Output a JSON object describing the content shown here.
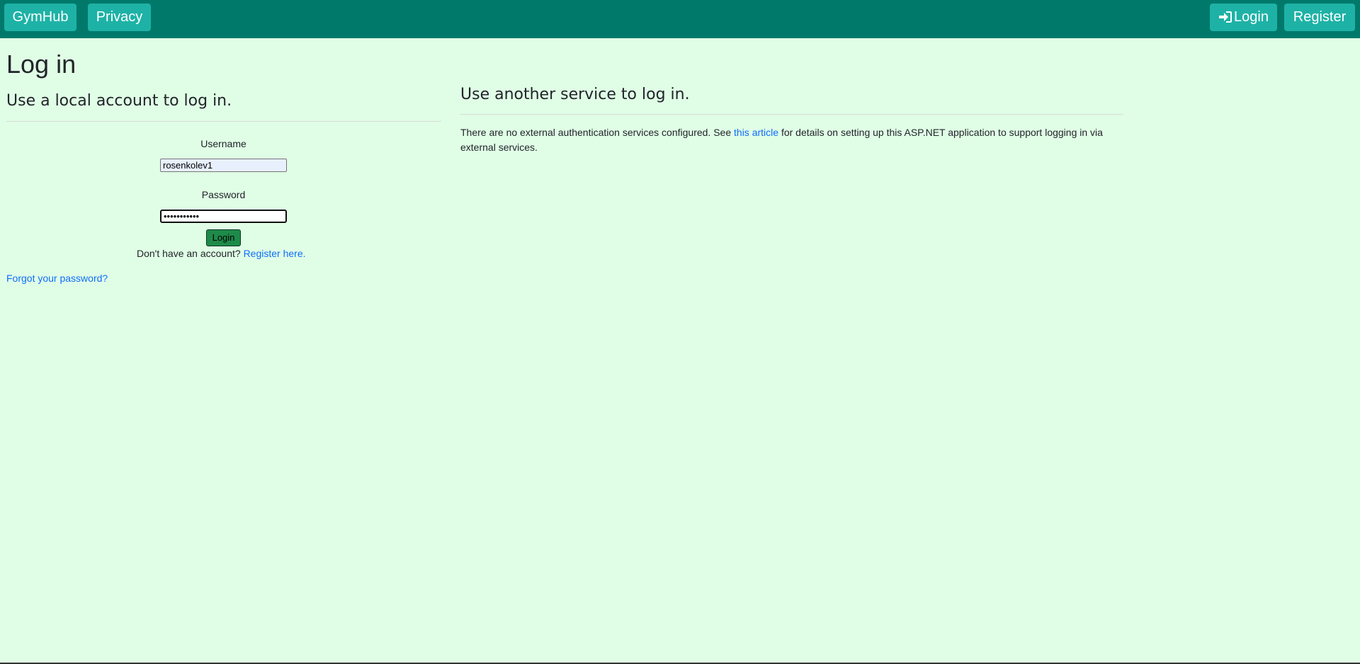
{
  "navbar": {
    "brand": "GymHub",
    "privacy": "Privacy",
    "login": "Login",
    "register": "Register",
    "login_icon": "sign-in-icon"
  },
  "page": {
    "title": "Log in"
  },
  "local": {
    "heading": "Use a local account to log in.",
    "username_label": "Username",
    "username_value": "rosenkolev1",
    "password_label": "Password",
    "password_value": "•••••••••••",
    "submit_label": "Login",
    "no_account_text": "Don't have an account?",
    "register_link": "Register here.",
    "forgot_link": "Forgot your password?"
  },
  "external": {
    "heading": "Use another service to log in.",
    "text_before": "There are no external authentication services configured. See",
    "article_link": "this article",
    "text_after": "for details on setting up this ASP.NET application to support logging in via external services."
  },
  "colors": {
    "navbar_bg": "#00796b",
    "nav_button_bg": "#1eb2a6",
    "page_bg": "#e0fde6",
    "link": "#0d6efd",
    "submit_bg": "#1e8a4a"
  }
}
